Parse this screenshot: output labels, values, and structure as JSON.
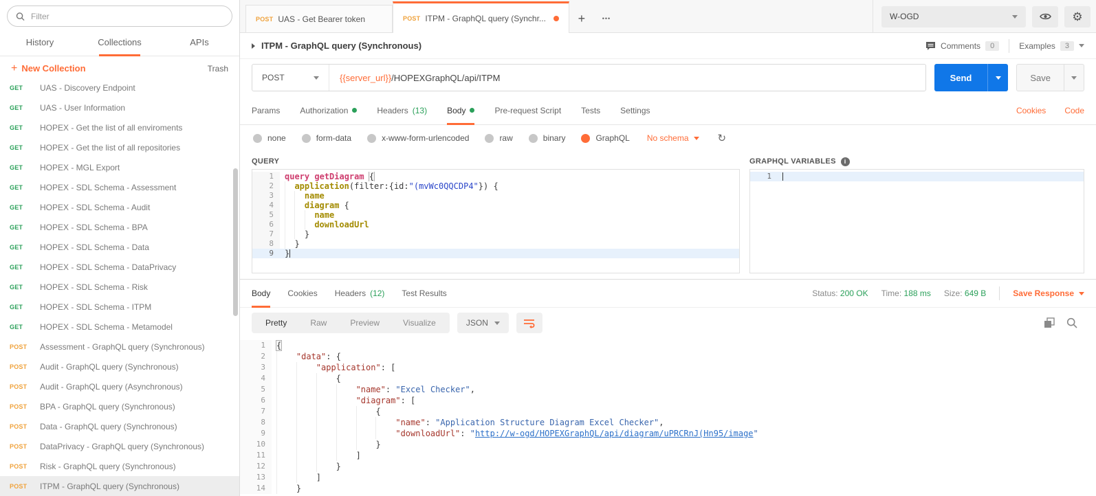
{
  "colors": {
    "orange": "#FF6C37",
    "green": "#2BA05A",
    "amber": "#EFA23C",
    "send_blue": "#1077E8",
    "link_blue": "#2D71C9",
    "json_key": "#A5362C",
    "json_value": "#3A66AD",
    "gql_keyword": "#CE3D6E",
    "gql_field": "#A38B00",
    "gql_string": "#2B46C9"
  },
  "sidebar": {
    "filter_placeholder": "Filter",
    "tabs": [
      {
        "label": "History",
        "active": false
      },
      {
        "label": "Collections",
        "active": true
      },
      {
        "label": "APIs",
        "active": false
      }
    ],
    "plus": "+",
    "new_collection_label": "New Collection",
    "trash_label": "Trash",
    "items": [
      {
        "method": "GET",
        "label": "UAS - Discovery Endpoint",
        "selected": false
      },
      {
        "method": "GET",
        "label": "UAS - User Information",
        "selected": false
      },
      {
        "method": "GET",
        "label": "HOPEX - Get the list of all enviroments",
        "selected": false
      },
      {
        "method": "GET",
        "label": "HOPEX - Get the list of all repositories",
        "selected": false
      },
      {
        "method": "GET",
        "label": "HOPEX - MGL Export",
        "selected": false
      },
      {
        "method": "GET",
        "label": "HOPEX - SDL Schema - Assessment",
        "selected": false
      },
      {
        "method": "GET",
        "label": "HOPEX - SDL Schema - Audit",
        "selected": false
      },
      {
        "method": "GET",
        "label": "HOPEX - SDL Schema - BPA",
        "selected": false
      },
      {
        "method": "GET",
        "label": "HOPEX - SDL Schema - Data",
        "selected": false
      },
      {
        "method": "GET",
        "label": "HOPEX - SDL Schema - DataPrivacy",
        "selected": false
      },
      {
        "method": "GET",
        "label": "HOPEX - SDL Schema - Risk",
        "selected": false
      },
      {
        "method": "GET",
        "label": "HOPEX - SDL Schema - ITPM",
        "selected": false
      },
      {
        "method": "GET",
        "label": "HOPEX - SDL Schema - Metamodel",
        "selected": false
      },
      {
        "method": "POST",
        "label": "Assessment - GraphQL query (Synchronous)",
        "selected": false
      },
      {
        "method": "POST",
        "label": "Audit - GraphQL query (Synchronous)",
        "selected": false
      },
      {
        "method": "POST",
        "label": "Audit - GraphQL query (Asynchronous)",
        "selected": false
      },
      {
        "method": "POST",
        "label": "BPA - GraphQL query (Synchronous)",
        "selected": false
      },
      {
        "method": "POST",
        "label": "Data - GraphQL query (Synchronous)",
        "selected": false
      },
      {
        "method": "POST",
        "label": "DataPrivacy - GraphQL query (Synchronous)",
        "selected": false
      },
      {
        "method": "POST",
        "label": "Risk - GraphQL query (Synchronous)",
        "selected": false
      },
      {
        "method": "POST",
        "label": "ITPM - GraphQL query (Synchronous)",
        "selected": true
      }
    ]
  },
  "topbar": {
    "tabs": [
      {
        "method": "POST",
        "label": "UAS - Get Bearer token",
        "active": false,
        "dirty": false
      },
      {
        "method": "POST",
        "label": "ITPM - GraphQL query (Synchr...",
        "active": true,
        "dirty": true
      }
    ],
    "new_tab": "+",
    "more_tabs": "•••",
    "environment": "W-OGD"
  },
  "request": {
    "title": "ITPM - GraphQL query (Synchronous)",
    "comments_label": "Comments",
    "comments_count": "0",
    "examples_label": "Examples",
    "examples_count": "3",
    "method": "POST",
    "url_variable": "{{server_url}}",
    "url_path": "/HOPEXGraphQL/api/ITPM",
    "send_label": "Send",
    "save_label": "Save",
    "tabs": [
      {
        "label": "Params"
      },
      {
        "label": "Authorization",
        "dot": true
      },
      {
        "label": "Headers",
        "count": "(13)"
      },
      {
        "label": "Body",
        "dot": true,
        "active": true
      },
      {
        "label": "Pre-request Script"
      },
      {
        "label": "Tests"
      },
      {
        "label": "Settings"
      }
    ],
    "cookies_label": "Cookies",
    "code_label": "Code",
    "body_modes": [
      {
        "label": "none",
        "selected": false
      },
      {
        "label": "form-data",
        "selected": false
      },
      {
        "label": "x-www-form-urlencoded",
        "selected": false
      },
      {
        "label": "raw",
        "selected": false
      },
      {
        "label": "binary",
        "selected": false
      },
      {
        "label": "GraphQL",
        "selected": true
      }
    ],
    "schema_label": "No schema"
  },
  "query_editor": {
    "label": "QUERY",
    "indent_unit": 2,
    "lines": [
      {
        "n": 1,
        "indent": 0,
        "tokens": [
          {
            "c": "kw",
            "t": "query"
          },
          {
            "c": "p",
            "t": " "
          },
          {
            "c": "kw",
            "t": "getDiagram"
          },
          {
            "c": "p",
            "t": " "
          },
          {
            "c": "p match",
            "t": "{"
          }
        ]
      },
      {
        "n": 2,
        "indent": 1,
        "tokens": [
          {
            "c": "field",
            "t": "application"
          },
          {
            "c": "p",
            "t": "(filter:{id:"
          },
          {
            "c": "str",
            "t": "\"(mvWc0QQCDP4\""
          },
          {
            "c": "p",
            "t": "}) {"
          }
        ]
      },
      {
        "n": 3,
        "indent": 2,
        "tokens": [
          {
            "c": "field",
            "t": "name"
          }
        ]
      },
      {
        "n": 4,
        "indent": 2,
        "tokens": [
          {
            "c": "field",
            "t": "diagram"
          },
          {
            "c": "p",
            "t": " {"
          }
        ]
      },
      {
        "n": 5,
        "indent": 3,
        "tokens": [
          {
            "c": "field",
            "t": "name"
          }
        ]
      },
      {
        "n": 6,
        "indent": 3,
        "tokens": [
          {
            "c": "field",
            "t": "downloadUrl"
          }
        ]
      },
      {
        "n": 7,
        "indent": 2,
        "tokens": [
          {
            "c": "p",
            "t": "}"
          }
        ]
      },
      {
        "n": 8,
        "indent": 1,
        "tokens": [
          {
            "c": "p",
            "t": "}"
          }
        ]
      },
      {
        "n": 9,
        "indent": 0,
        "active": true,
        "cursor": true,
        "tokens": [
          {
            "c": "p",
            "t": "}"
          }
        ]
      }
    ]
  },
  "variables_editor": {
    "label": "GRAPHQL VARIABLES",
    "indent_unit": 2,
    "lines": [
      {
        "n": 1,
        "indent": 0,
        "active": true,
        "cursor": true,
        "tokens": []
      }
    ]
  },
  "response": {
    "tabs": [
      {
        "label": "Body",
        "active": true
      },
      {
        "label": "Cookies"
      },
      {
        "label": "Headers",
        "count": "(12)"
      },
      {
        "label": "Test Results"
      }
    ],
    "status_label": "Status:",
    "status_value": "200 OK",
    "time_label": "Time:",
    "time_value": "188 ms",
    "size_label": "Size:",
    "size_value": "649 B",
    "save_response_label": "Save Response",
    "view_tabs": [
      {
        "label": "Pretty",
        "active": true
      },
      {
        "label": "Raw"
      },
      {
        "label": "Preview"
      },
      {
        "label": "Visualize"
      }
    ],
    "format_label": "JSON",
    "editor": {
      "indent_unit": 4,
      "lines": [
        {
          "n": 1,
          "indent": 0,
          "tokens": [
            {
              "c": "p match",
              "t": "{"
            }
          ]
        },
        {
          "n": 2,
          "indent": 1,
          "tokens": [
            {
              "c": "key",
              "t": "\"data\""
            },
            {
              "c": "p",
              "t": ": {"
            }
          ]
        },
        {
          "n": 3,
          "indent": 2,
          "tokens": [
            {
              "c": "key",
              "t": "\"application\""
            },
            {
              "c": "p",
              "t": ": ["
            }
          ]
        },
        {
          "n": 4,
          "indent": 3,
          "tokens": [
            {
              "c": "p",
              "t": "{"
            }
          ]
        },
        {
          "n": 5,
          "indent": 4,
          "tokens": [
            {
              "c": "key",
              "t": "\"name\""
            },
            {
              "c": "p",
              "t": ": "
            },
            {
              "c": "val",
              "t": "\"Excel Checker\""
            },
            {
              "c": "p",
              "t": ","
            }
          ]
        },
        {
          "n": 6,
          "indent": 4,
          "tokens": [
            {
              "c": "key",
              "t": "\"diagram\""
            },
            {
              "c": "p",
              "t": ": ["
            }
          ]
        },
        {
          "n": 7,
          "indent": 5,
          "tokens": [
            {
              "c": "p",
              "t": "{"
            }
          ]
        },
        {
          "n": 8,
          "indent": 6,
          "tokens": [
            {
              "c": "key",
              "t": "\"name\""
            },
            {
              "c": "p",
              "t": ": "
            },
            {
              "c": "val",
              "t": "\"Application Structure Diagram Excel Checker\""
            },
            {
              "c": "p",
              "t": ","
            }
          ]
        },
        {
          "n": 9,
          "indent": 6,
          "tokens": [
            {
              "c": "key",
              "t": "\"downloadUrl\""
            },
            {
              "c": "p",
              "t": ": "
            },
            {
              "c": "val",
              "t": "\""
            },
            {
              "c": "link",
              "t": "http://w-ogd/HOPEXGraphQL/api/diagram/uPRCRnJ(Hn95/image"
            },
            {
              "c": "val",
              "t": "\""
            }
          ]
        },
        {
          "n": 10,
          "indent": 5,
          "tokens": [
            {
              "c": "p",
              "t": "}"
            }
          ]
        },
        {
          "n": 11,
          "indent": 4,
          "tokens": [
            {
              "c": "p",
              "t": "]"
            }
          ]
        },
        {
          "n": 12,
          "indent": 3,
          "tokens": [
            {
              "c": "p",
              "t": "}"
            }
          ]
        },
        {
          "n": 13,
          "indent": 2,
          "tokens": [
            {
              "c": "p",
              "t": "]"
            }
          ]
        },
        {
          "n": 14,
          "indent": 1,
          "tokens": [
            {
              "c": "p",
              "t": "}"
            }
          ]
        }
      ]
    }
  }
}
